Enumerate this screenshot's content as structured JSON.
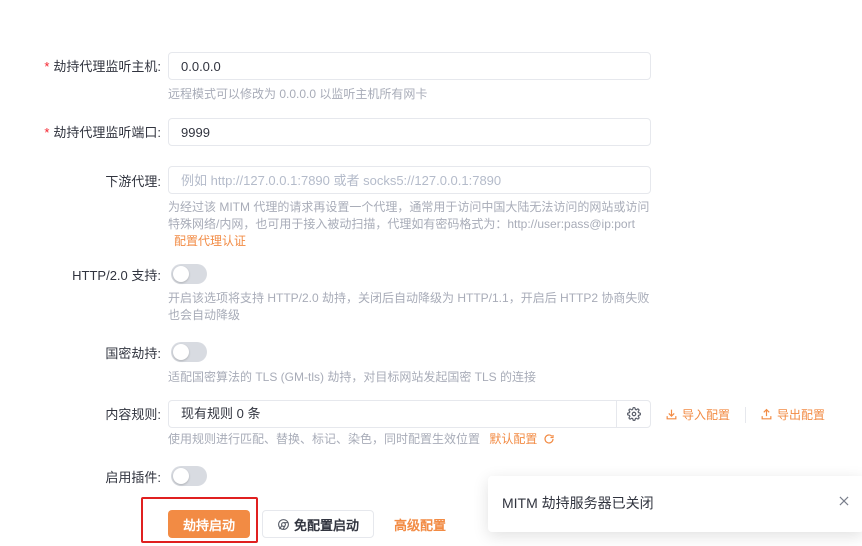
{
  "form": {
    "host": {
      "label": "劫持代理监听主机:",
      "value": "0.0.0.0",
      "help": "远程模式可以修改为 0.0.0.0 以监听主机所有网卡"
    },
    "port": {
      "label": "劫持代理监听端口:",
      "value": "9999"
    },
    "downstream": {
      "label": "下游代理:",
      "placeholder": "例如 http://127.0.0.1:7890 或者 socks5://127.0.0.1:7890",
      "help": "为经过该 MITM 代理的请求再设置一个代理，通常用于访问中国大陆无法访问的网站或访问特殊网络/内网，也可用于接入被动扫描，代理如有密码格式为：http://user:pass@ip:port",
      "auth_link": "配置代理认证"
    },
    "http2": {
      "label": "HTTP/2.0 支持:",
      "enabled": false,
      "help": "开启该选项将支持 HTTP/2.0 劫持，关闭后自动降级为 HTTP/1.1，开启后 HTTP2 协商失败也会自动降级"
    },
    "gm": {
      "label": "国密劫持:",
      "enabled": false,
      "help": "适配国密算法的 TLS (GM-tls) 劫持，对目标网站发起国密 TLS 的连接"
    },
    "rules": {
      "label": "内容规则:",
      "value": "现有规则 0 条",
      "import_label": "导入配置",
      "export_label": "导出配置",
      "help": "使用规则进行匹配、替换、标记、染色，同时配置生效位置",
      "default_link": "默认配置"
    },
    "plugins": {
      "label": "启用插件:",
      "enabled": false
    }
  },
  "actions": {
    "start_label": "劫持启动",
    "no_config_label": "免配置启动",
    "advanced_label": "高级配置"
  },
  "toast": {
    "message": "MITM 劫持服务器已关闭"
  },
  "colors": {
    "accent": "#f28b44",
    "required": "#f5222d",
    "highlight": "#e02020"
  }
}
